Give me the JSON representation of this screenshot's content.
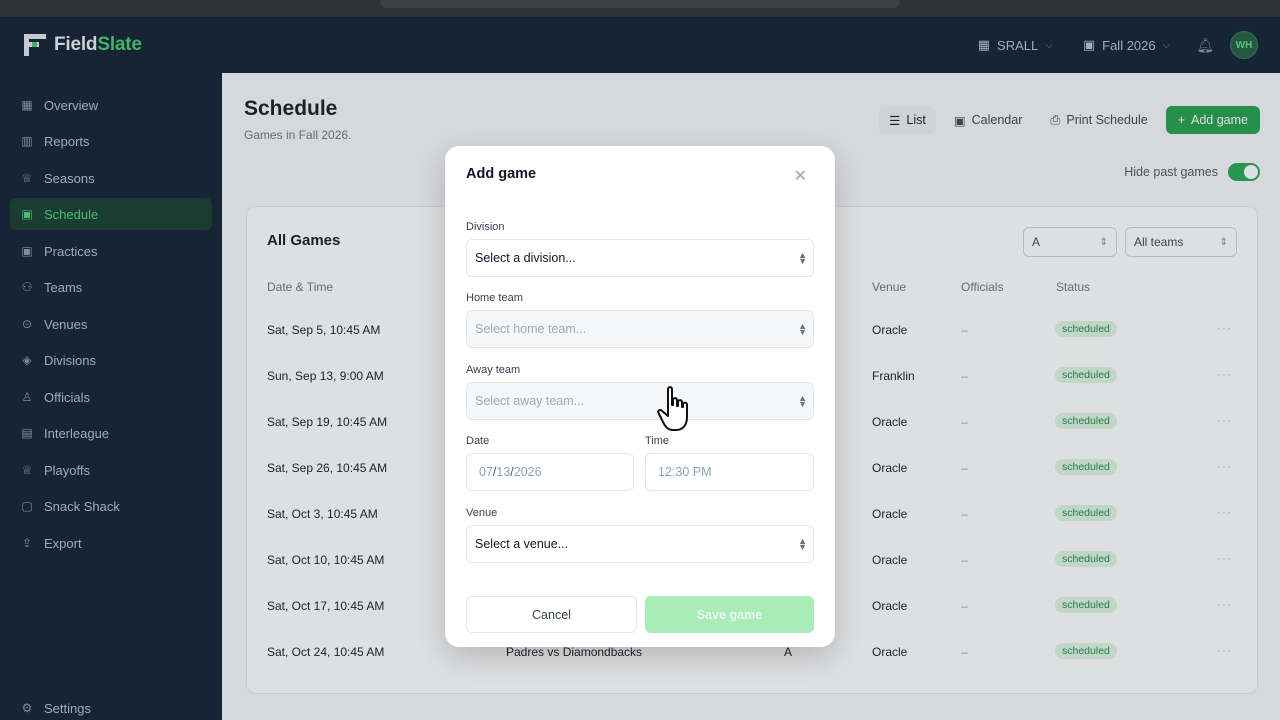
{
  "app": {
    "name_part1": "Field",
    "name_part2": "Slate"
  },
  "topbar": {
    "org": "SRALL",
    "season": "Fall 2026",
    "avatar_initials": "WH"
  },
  "sidebar": {
    "items": [
      {
        "label": "Overview",
        "icon": "grid-icon"
      },
      {
        "label": "Reports",
        "icon": "bar-chart-icon"
      },
      {
        "label": "Seasons",
        "icon": "trophy-icon"
      },
      {
        "label": "Schedule",
        "icon": "calendar-icon"
      },
      {
        "label": "Practices",
        "icon": "calendar-icon"
      },
      {
        "label": "Teams",
        "icon": "users-icon"
      },
      {
        "label": "Venues",
        "icon": "map-pin-icon"
      },
      {
        "label": "Divisions",
        "icon": "layers-icon"
      },
      {
        "label": "Officials",
        "icon": "user-check-icon"
      },
      {
        "label": "Interleague",
        "icon": "building-icon"
      },
      {
        "label": "Playoffs",
        "icon": "trophy-icon"
      },
      {
        "label": "Snack Shack",
        "icon": "receipt-icon"
      },
      {
        "label": "Export",
        "icon": "export-icon"
      }
    ],
    "active": "Schedule",
    "settings": "Settings"
  },
  "page": {
    "title": "Schedule",
    "subtitle": "Games in Fall 2026.",
    "list_label": "List",
    "calendar_label": "Calendar",
    "print_label": "Print Schedule",
    "add_label": "Add game",
    "hide_past_label": "Hide past games",
    "hide_past_on": true
  },
  "games_card": {
    "title": "All Games",
    "division_filter": "A",
    "team_filter": "All teams",
    "columns": {
      "date": "Date & Time",
      "venue": "Venue",
      "officials": "Officials",
      "status": "Status"
    },
    "rows": [
      {
        "date": "Sat, Sep 5, 10:45 AM",
        "venue": "Oracle",
        "officials": "–",
        "status": "scheduled"
      },
      {
        "date": "Sun, Sep 13, 9:00 AM",
        "venue": "Franklin",
        "officials": "–",
        "status": "scheduled"
      },
      {
        "date": "Sat, Sep 19, 10:45 AM",
        "venue": "Oracle",
        "officials": "–",
        "status": "scheduled"
      },
      {
        "date": "Sat, Sep 26, 10:45 AM",
        "venue": "Oracle",
        "officials": "–",
        "status": "scheduled"
      },
      {
        "date": "Sat, Oct 3, 10:45 AM",
        "venue": "Oracle",
        "officials": "–",
        "status": "scheduled"
      },
      {
        "date": "Sat, Oct 10, 10:45 AM",
        "venue": "Oracle",
        "officials": "–",
        "status": "scheduled"
      },
      {
        "date": "Sat, Oct 17, 10:45 AM",
        "venue": "Oracle",
        "officials": "–",
        "status": "scheduled"
      },
      {
        "date": "Sat, Oct 24, 10:45 AM",
        "matchup": "Padres vs Diamondbacks",
        "division": "A",
        "venue": "Oracle",
        "officials": "–",
        "status": "scheduled"
      }
    ]
  },
  "modal": {
    "title": "Add game",
    "division_label": "Division",
    "division_value": "Select a division...",
    "home_label": "Home team",
    "home_value": "Select home team...",
    "away_label": "Away team",
    "away_value": "Select away team...",
    "date_label": "Date",
    "date_mm": "07",
    "date_dd": "13",
    "date_yyyy": "2026",
    "time_label": "Time",
    "time_value": "12:30 PM",
    "venue_label": "Venue",
    "venue_value": "Select a venue...",
    "cancel_label": "Cancel",
    "save_label": "Save game"
  },
  "colors": {
    "brand": "#1e9e4a",
    "sidebar_bg": "#0d1b30",
    "badge_bg": "#dcf5e3"
  }
}
